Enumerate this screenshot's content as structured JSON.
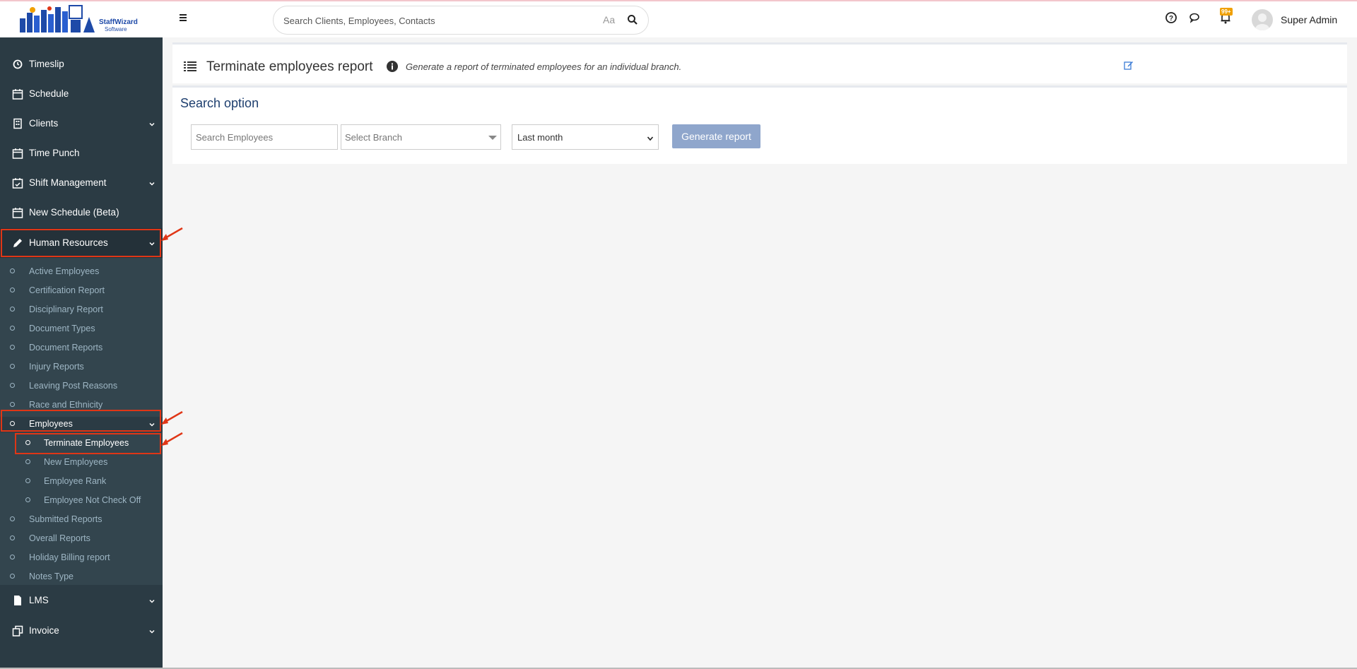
{
  "app": {
    "logo_brand": "StaffWizard",
    "logo_sub": "Software"
  },
  "header": {
    "search_placeholder": "Search Clients, Employees, Contacts",
    "case_toggle": "Aa",
    "notification_count": "99+",
    "user_name": "Super Admin"
  },
  "sidebar": {
    "items": [
      {
        "label": "Timeslip",
        "icon": "clock-icon"
      },
      {
        "label": "Schedule",
        "icon": "calendar-icon"
      },
      {
        "label": "Clients",
        "icon": "building-icon"
      },
      {
        "label": "Time Punch",
        "icon": "calendar-icon"
      },
      {
        "label": "Shift Management",
        "icon": "calendar-check-icon"
      },
      {
        "label": "New Schedule (Beta)",
        "icon": "calendar-icon"
      },
      {
        "label": "Human Resources",
        "icon": "pencil-icon"
      },
      {
        "label": "LMS",
        "icon": "file-icon"
      },
      {
        "label": "Invoice",
        "icon": "copy-icon"
      }
    ],
    "hr_sub": [
      "Active Employees",
      "Certification Report",
      "Disciplinary Report",
      "Document Types",
      "Document Reports",
      "Injury Reports",
      "Leaving Post Reasons",
      "Race and Ethnicity",
      "Employees",
      "Submitted Reports",
      "Overall Reports",
      "Holiday Billing report",
      "Notes Type"
    ],
    "employees_sub": [
      "Terminate Employees",
      "New Employees",
      "Employee Rank",
      "Employee Not Check Off"
    ]
  },
  "page": {
    "title": "Terminate employees report",
    "description": "Generate a report of terminated employees for an individual branch.",
    "search_title": "Search option",
    "search_employees_placeholder": "Search Employees",
    "branch_placeholder": "Select Branch",
    "period_value": "Last month",
    "generate_label": "Generate report"
  },
  "colors": {
    "sidebar_bg": "#2b3b44",
    "submenu_bg": "#33454e",
    "highlight": "#e03616",
    "button": "#8fa6cc",
    "heading": "#1d3e6e"
  }
}
